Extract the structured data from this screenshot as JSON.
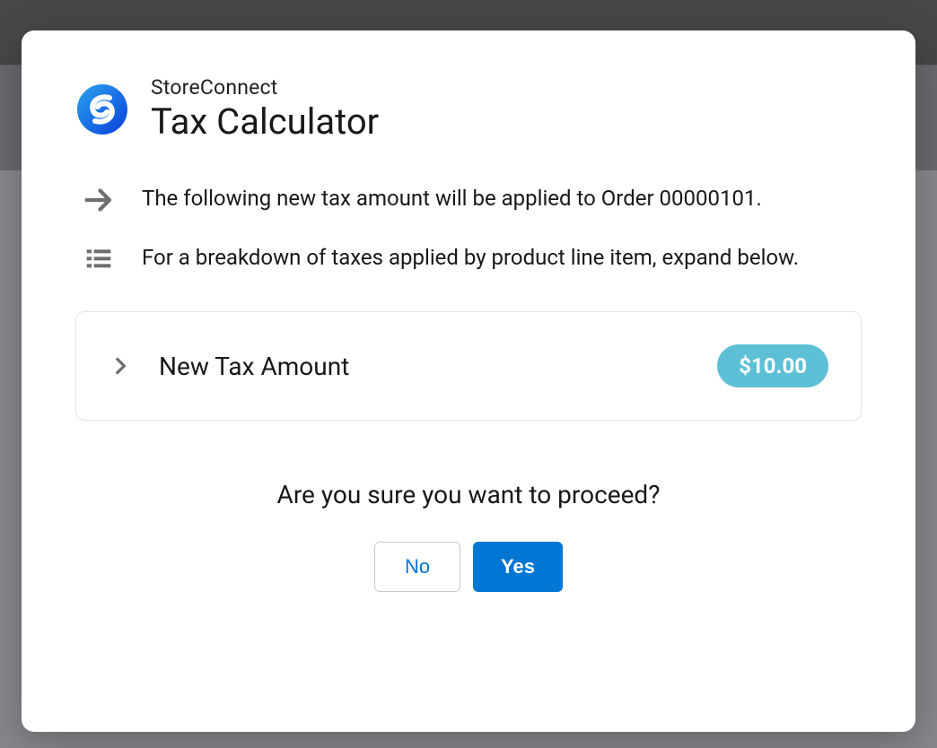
{
  "header": {
    "overline": "StoreConnect",
    "title": "Tax Calculator"
  },
  "info": {
    "line1": "The following new tax amount will be applied to Order 00000101.",
    "line2": "For a breakdown of taxes applied by product line item, expand below."
  },
  "expand": {
    "label": "New Tax Amount",
    "amount": "$10.00"
  },
  "confirm": {
    "prompt": "Are you sure you want to proceed?",
    "no": "No",
    "yes": "Yes"
  },
  "colors": {
    "primary": "#0176d3",
    "badge": "#5ec0d6"
  }
}
